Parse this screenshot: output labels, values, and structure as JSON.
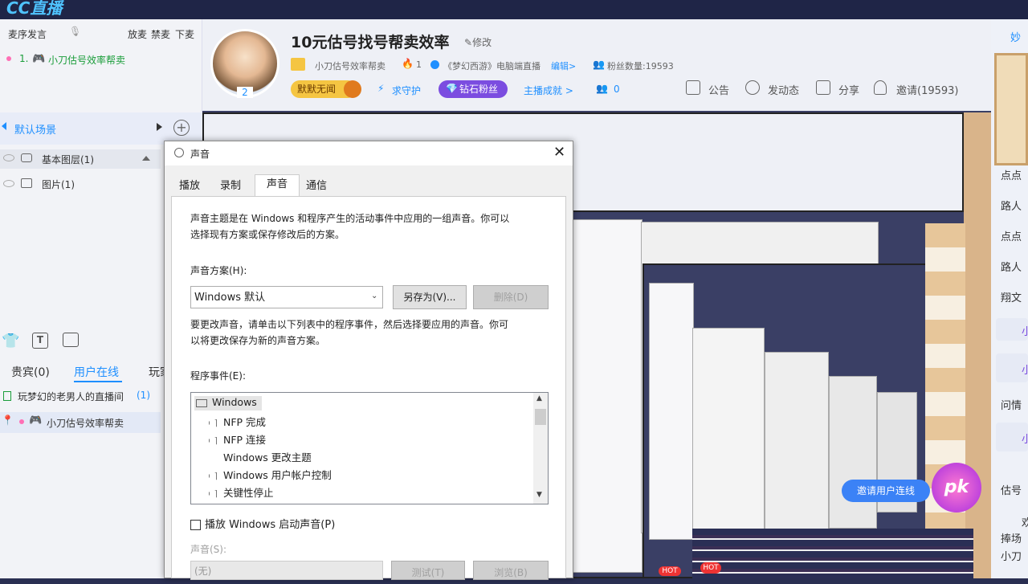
{
  "app": {
    "logo": "CC直播"
  },
  "left": {
    "mic_order": "麦序发言",
    "actions": [
      "放麦",
      "禁麦",
      "下麦"
    ],
    "mic_list": [
      "1.",
      "小刀估号效率帮卖"
    ],
    "scene": "默认场景",
    "layers": [
      "基本图层(1)",
      "图片(1)"
    ],
    "tabs": [
      "贵宾(0)",
      "用户在线",
      "玩家"
    ],
    "room": {
      "name": "玩梦幻的老男人的直播间",
      "count": "(1)"
    },
    "user": "小刀估号效率帮卖"
  },
  "header": {
    "title": "10元估号找号帮卖效率",
    "edit": "修改",
    "anchor": "小刀估号效率帮卖",
    "fire_count": "1",
    "game": "《梦幻西游》电脑端直播",
    "edit_link": "编辑>",
    "fans_label": "粉丝数量:19593",
    "avatar_count": "2",
    "badge1": "默默无闻",
    "guard": "求守护",
    "diamond": "钻石粉丝",
    "achievement": "主播成就 >",
    "share_count": "0",
    "tools": [
      "公告",
      "发动态",
      "分享",
      "邀请(19593)"
    ]
  },
  "right": {
    "items": [
      "妙",
      "点点",
      "路人",
      "点点",
      "路人",
      "翔文",
      "小",
      "小",
      "问情",
      "小",
      "估号",
      "欢",
      "捧场",
      "小刀"
    ]
  },
  "dialog": {
    "title": "声音",
    "tabs": [
      "播放",
      "录制",
      "声音",
      "通信"
    ],
    "desc": [
      "声音主题是在 Windows 和程序产生的活动事件中应用的一组声音。你可以",
      "选择现有方案或保存修改后的方案。"
    ],
    "scheme_label": "声音方案(H):",
    "scheme_value": "Windows 默认",
    "save_as": "另存为(V)...",
    "delete": "删除(D)",
    "desc2": [
      "要更改声音，请单击以下列表中的程序事件，然后选择要应用的声音。你可",
      "以将更改保存为新的声音方案。"
    ],
    "events_label": "程序事件(E):",
    "events": [
      "Windows",
      "NFP 完成",
      "NFP 连接",
      "Windows 更改主题",
      "Windows 用户帐户控制",
      "关键性停止"
    ],
    "startup": "播放 Windows 启动声音(P)",
    "sound_label": "声音(S):",
    "sound_value": "(无)",
    "test": "测试(T)",
    "browse": "浏览(B)"
  },
  "pk": {
    "invite": "邀请用户连线",
    "label": "pk"
  },
  "colors": {
    "accent": "#1e8fff",
    "bg": "#2a2f52",
    "header": "#eef0f6",
    "gold": "#f5c542",
    "purple": "#7b4de0"
  }
}
